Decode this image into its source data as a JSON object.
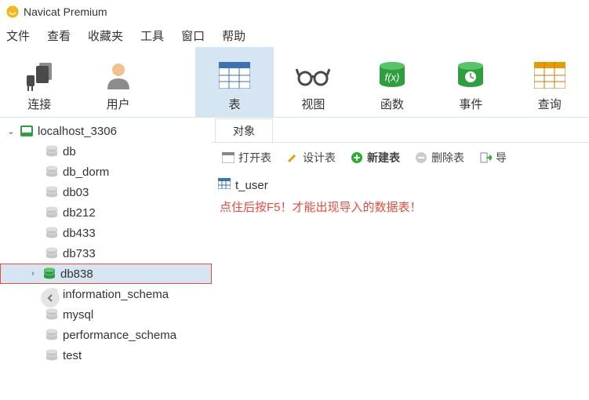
{
  "window": {
    "title": "Navicat Premium"
  },
  "menu": {
    "file": "文件",
    "view": "查看",
    "favorites": "收藏夹",
    "tools": "工具",
    "window": "窗口",
    "help": "帮助"
  },
  "toolbar": {
    "connect": "连接",
    "user": "用户",
    "table": "表",
    "view": "视图",
    "function": "函数",
    "event": "事件",
    "query": "查询"
  },
  "tree": {
    "connection": "localhost_3306",
    "items": [
      {
        "label": "db"
      },
      {
        "label": "db_dorm"
      },
      {
        "label": "db03"
      },
      {
        "label": "db212"
      },
      {
        "label": "db433"
      },
      {
        "label": "db733"
      },
      {
        "label": "db838",
        "selected": true,
        "active": true
      },
      {
        "label": "information_schema"
      },
      {
        "label": "mysql"
      },
      {
        "label": "performance_schema"
      },
      {
        "label": "test"
      }
    ]
  },
  "annotation": "点住后按F5！才能出现导入的数据表！",
  "right": {
    "tab": "对象",
    "buttons": {
      "open": "打开表",
      "design": "设计表",
      "new": "新建表",
      "delete": "删除表",
      "import": "导"
    },
    "objects": [
      {
        "name": "t_user"
      }
    ]
  }
}
